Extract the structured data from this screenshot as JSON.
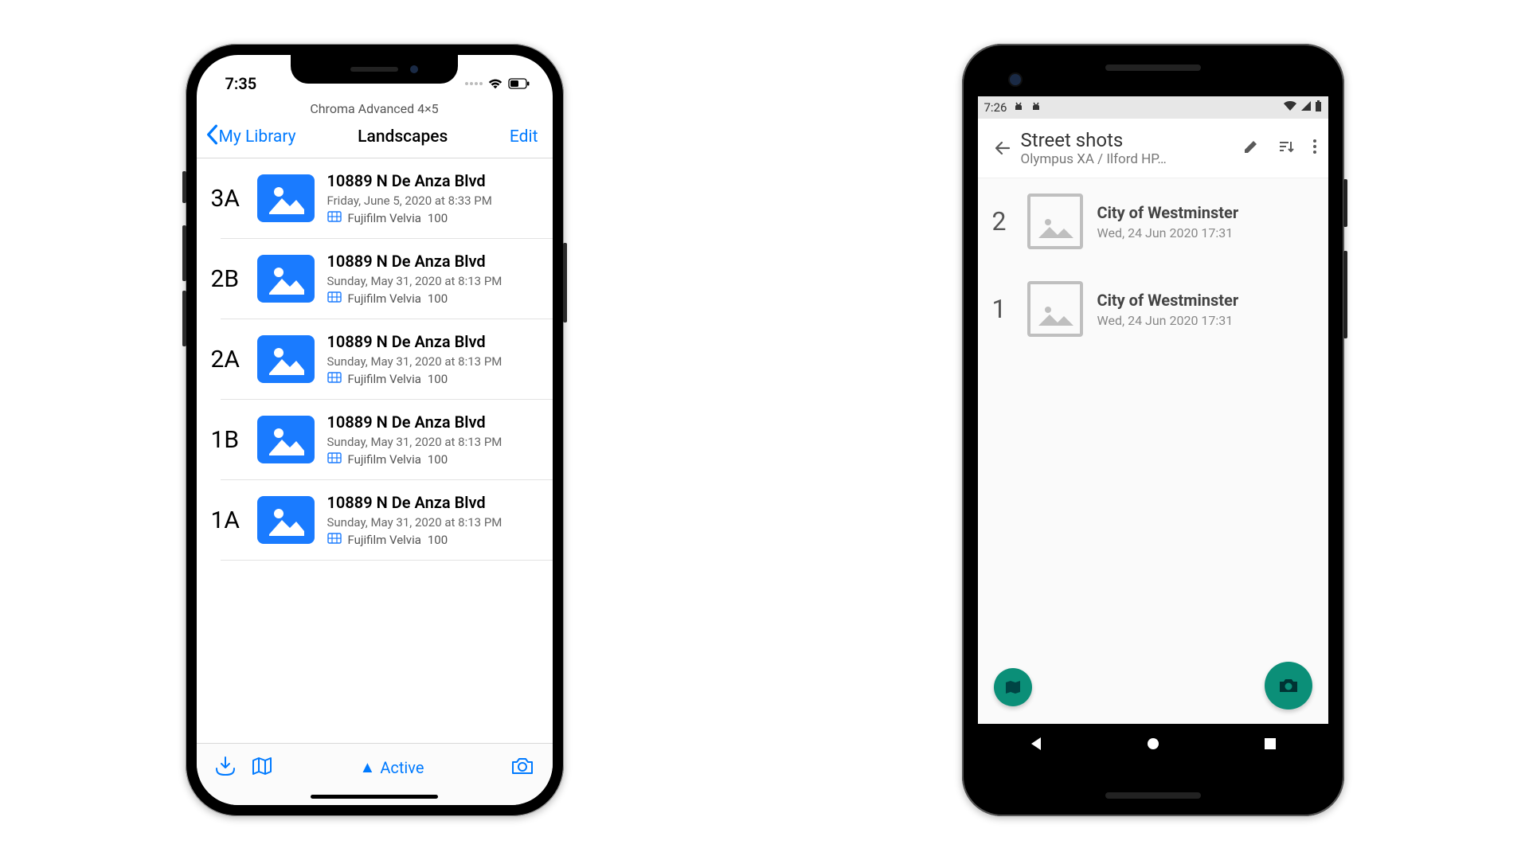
{
  "ios": {
    "status_time": "7:35",
    "caption": "Chroma Advanced 4×5",
    "back_label": "My Library",
    "page_title": "Landscapes",
    "edit_label": "Edit",
    "toolbar_center": "Active",
    "rows": [
      {
        "idx": "3A",
        "title": "10889 N De Anza Blvd",
        "date": "Friday, June 5, 2020 at 8:33 PM",
        "film": "Fujifilm Velvia",
        "iso": "100"
      },
      {
        "idx": "2B",
        "title": "10889 N De Anza Blvd",
        "date": "Sunday, May 31, 2020 at 8:13 PM",
        "film": "Fujifilm Velvia",
        "iso": "100"
      },
      {
        "idx": "2A",
        "title": "10889 N De Anza Blvd",
        "date": "Sunday, May 31, 2020 at 8:13 PM",
        "film": "Fujifilm Velvia",
        "iso": "100"
      },
      {
        "idx": "1B",
        "title": "10889 N De Anza Blvd",
        "date": "Sunday, May 31, 2020 at 8:13 PM",
        "film": "Fujifilm Velvia",
        "iso": "100"
      },
      {
        "idx": "1A",
        "title": "10889 N De Anza Blvd",
        "date": "Sunday, May 31, 2020 at 8:13 PM",
        "film": "Fujifilm Velvia",
        "iso": "100"
      }
    ]
  },
  "android": {
    "status_time": "7:26",
    "title": "Street shots",
    "subtitle": "Olympus XA / Ilford HP…",
    "rows": [
      {
        "idx": "2",
        "title": "City of Westminster",
        "date": "Wed, 24 Jun 2020 17:31"
      },
      {
        "idx": "1",
        "title": "City of Westminster",
        "date": "Wed, 24 Jun 2020 17:31"
      }
    ]
  }
}
